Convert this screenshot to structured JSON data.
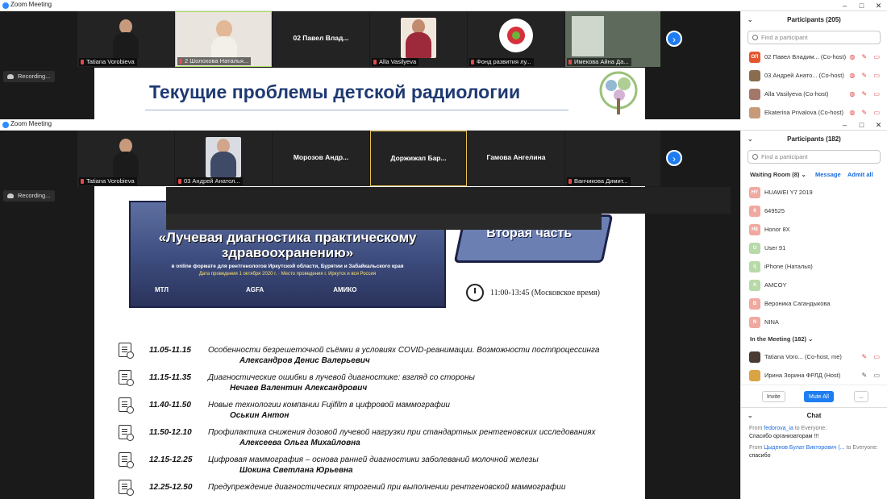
{
  "window1": {
    "title": "Zoom Meeting",
    "tiles": [
      {
        "name": "Tatiana Vorobieva",
        "type": "video"
      },
      {
        "name": "2 Шолохова Наталья...",
        "type": "video",
        "active": true
      },
      {
        "name": "",
        "center": "02 Павел Влад...",
        "type": "name"
      },
      {
        "name": "Alla Vasilyeva",
        "type": "video"
      },
      {
        "name": "Фонд развития лу...",
        "type": "logo"
      },
      {
        "name": "Имекова Айна Да...",
        "type": "video"
      }
    ],
    "recording": "Recording...",
    "slide_title": "Текущие проблемы детской радиологии",
    "panel": {
      "title": "Participants (205)",
      "search_placeholder": "Find a participant",
      "rows": [
        {
          "initials": "ОП",
          "name": "02 Павел Владим... (Co-host)",
          "color": "#e4572e"
        },
        {
          "initials": "",
          "name": "03 Андрей Анато... (Co-host)",
          "color": "#8a6d4f"
        },
        {
          "initials": "",
          "name": "Alla Vasilyeva (Co-host)",
          "color": "#a3776a"
        },
        {
          "initials": "",
          "name": "Ekaterina Privalova (Co-host)",
          "color": "#c79b7a"
        }
      ]
    }
  },
  "window2": {
    "title": "Zoom Meeting",
    "tiles": [
      {
        "name": "Tatiana Vorobieva",
        "type": "video"
      },
      {
        "name": "03 Андрей Анатол...",
        "type": "video"
      },
      {
        "name": "",
        "center": "Морозов Андр...",
        "type": "name"
      },
      {
        "name": "",
        "center": "Доржижап Бар...",
        "type": "name",
        "speaking": true
      },
      {
        "name": "",
        "center": "Гамова Ангелина",
        "type": "name"
      },
      {
        "name": "Ванчикова Димит...",
        "type": "name"
      }
    ],
    "recording": "Recording...",
    "slide": {
      "banner_title": "«Лучевая диагностика практическому здравоохранению»",
      "banner_sub": "в online формате для рентгенологов Иркутской области, Бурятии и Забайкальского края",
      "banner_date": "Дата проведения 1 октября 2020 г. · Место проведения г. Иркутск и вся Россия",
      "logos": [
        "МТЛ",
        "AGFA",
        "АМИКО"
      ],
      "part": "Вторая часть",
      "time": "11:00-13:45 (Московское время)",
      "program": [
        {
          "time": "11.05-11.15",
          "topic": "Особенности безрешеточной съёмки в условиях COVID-реанимации. Возможности постпроцессинга",
          "speaker": "Александров Денис Валерьевич"
        },
        {
          "time": "11.15-11.35",
          "topic": "Диагностические ошибки в лучевой диагностике: взгляд со стороны",
          "speaker": "Нечаев Валентин Александрович"
        },
        {
          "time": "11.40-11.50",
          "topic": "Новые технологии компании Fujifilm в цифровой маммографии",
          "speaker": "Оськин Антон"
        },
        {
          "time": "11.50-12.10",
          "topic": "Профилактика снижения дозовой лучевой нагрузки при стандартных рентгеновских исследованиях",
          "speaker": "Алексеева Ольга Михайловна"
        },
        {
          "time": "12.15-12.25",
          "topic": "Цифровая маммография – основа ранней диагностики заболеваний молочной железы",
          "speaker": "Шокина Светлана Юрьевна"
        },
        {
          "time": "12.25-12.50",
          "topic": "Предупреждение диагностических ятрогений при выполнении рентгеновской маммографии",
          "speaker": ""
        }
      ]
    },
    "panel": {
      "title": "Participants (182)",
      "search_placeholder": "Find a participant",
      "waiting_label": "Waiting Room (8)",
      "message_label": "Message",
      "admit_label": "Admit all",
      "waiting": [
        {
          "initials": "HY",
          "name": "HUAWEI Y7 2019",
          "color": "#f0a9a0"
        },
        {
          "initials": "6",
          "name": "649525",
          "color": "#f0a9a0"
        },
        {
          "initials": "H8",
          "name": "Honor 8X",
          "color": "#f0a9a0"
        },
        {
          "initials": "U",
          "name": "User 91",
          "color": "#b8d9a8"
        },
        {
          "initials": "i(",
          "name": "iPhone (Наталья)",
          "color": "#b8d9a8"
        },
        {
          "initials": "A",
          "name": "AMCOY",
          "color": "#b8d9a8"
        },
        {
          "initials": "B",
          "name": "Вероника Сагандыкова",
          "color": "#f0a9a0"
        },
        {
          "initials": "N",
          "name": "NINA",
          "color": "#f0a9a0"
        }
      ],
      "meeting_label": "In the Meeting (182)",
      "meeting": [
        {
          "initials": "",
          "name": "Tatiana Voro... (Co-host, me)",
          "color": "#4a3b32"
        },
        {
          "initials": "",
          "name": "Ирина Зорина ФРЛД (Host)",
          "color": "#d9a441"
        }
      ],
      "buttons": {
        "invite": "Invite",
        "mute_all": "Mute All",
        "more": "..."
      },
      "chat_title": "Chat",
      "messages": [
        {
          "from": "From",
          "sender": "fedorova_ia",
          "to": "to Everyone:",
          "text": "Спасибо организаторам !!!"
        },
        {
          "from": "From",
          "sender": "Цыденов Булат Викторович (...",
          "to": "to Everyone:",
          "text": "спасибо"
        }
      ]
    }
  }
}
